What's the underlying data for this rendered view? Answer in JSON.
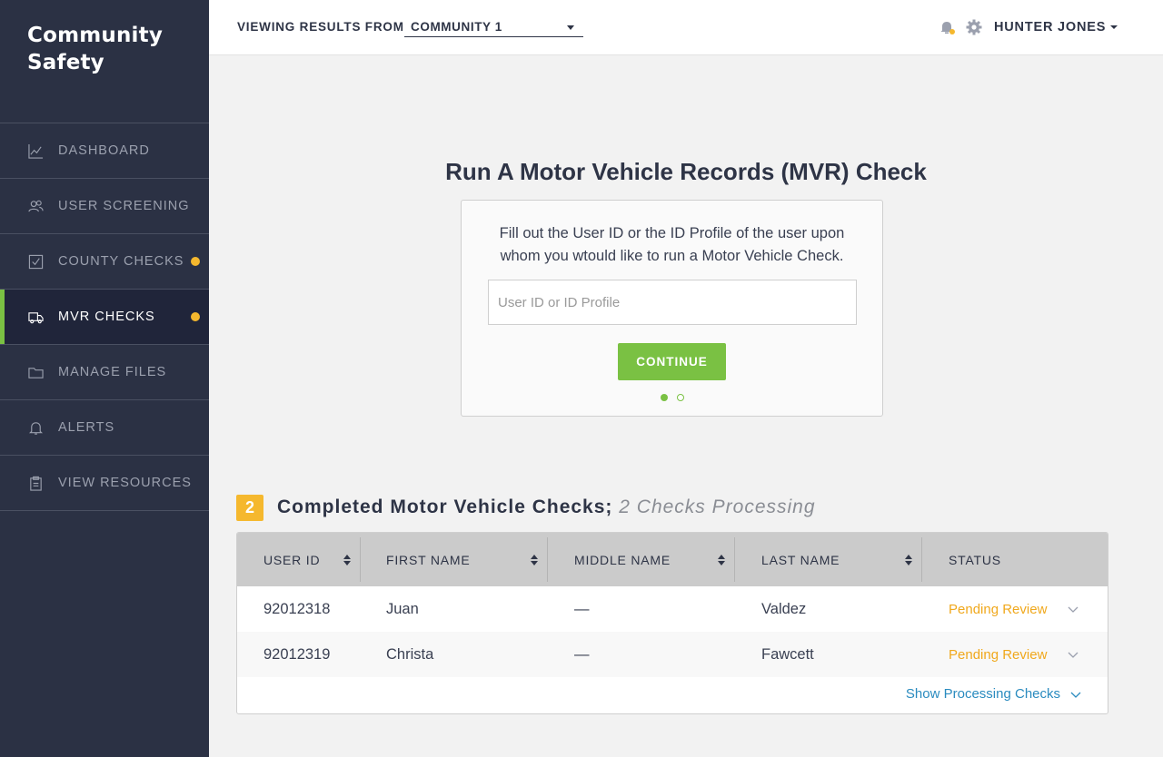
{
  "brand": {
    "title": "Community Safety"
  },
  "sidebar": {
    "items": [
      {
        "label": "DASHBOARD",
        "icon": "chart-icon",
        "active": false,
        "dot": false
      },
      {
        "label": "USER SCREENING",
        "icon": "users-icon",
        "active": false,
        "dot": false
      },
      {
        "label": "COUNTY CHECKS",
        "icon": "checkbox-icon",
        "active": false,
        "dot": true
      },
      {
        "label": "MVR CHECKS",
        "icon": "truck-icon",
        "active": true,
        "dot": true
      },
      {
        "label": "MANAGE FILES",
        "icon": "folder-icon",
        "active": false,
        "dot": false
      },
      {
        "label": "ALERTS",
        "icon": "bell-icon",
        "active": false,
        "dot": false
      },
      {
        "label": "VIEW RESOURCES",
        "icon": "clipboard-icon",
        "active": false,
        "dot": false
      }
    ],
    "accent_color": "#7ac143",
    "dot_color": "#f5b82e"
  },
  "header": {
    "viewing_label": "VIEWING RESULTS FROM",
    "community_selected": "COMMUNITY 1",
    "user_name": "HUNTER JONES"
  },
  "mvr": {
    "title": "Run A Motor Vehicle Records (MVR) Check",
    "description": "Fill out the User ID or the ID Profile of the user upon whom you wtould like to run a Motor Vehicle Check.",
    "input_placeholder": "User ID or ID Profile",
    "input_value": "",
    "continue_label": "CONTINUE",
    "step_current": 1,
    "step_total": 2
  },
  "completed": {
    "count": "2",
    "title": "Completed Motor Vehicle Checks;",
    "subtitle": "2 Checks Processing",
    "columns": [
      "USER ID",
      "FIRST NAME",
      "MIDDLE NAME",
      "LAST NAME",
      "STATUS"
    ],
    "rows": [
      {
        "user_id": "92012318",
        "first_name": "Juan",
        "middle_name": "—",
        "last_name": "Valdez",
        "status": "Pending Review"
      },
      {
        "user_id": "92012319",
        "first_name": "Christa",
        "middle_name": "—",
        "last_name": "Fawcett",
        "status": "Pending Review"
      }
    ],
    "show_processing_label": "Show Processing Checks"
  }
}
